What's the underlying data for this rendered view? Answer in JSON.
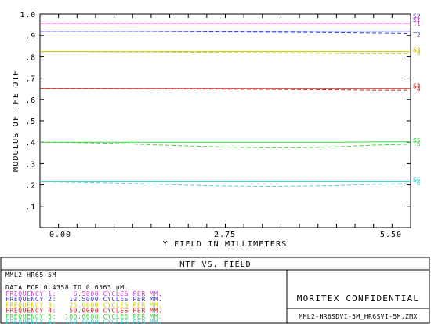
{
  "chart_data": {
    "type": "line",
    "title": "MTF VS. FIELD",
    "xlabel": "Y FIELD IN MILLIMETERS",
    "ylabel": "MODULUS OF THE OTF",
    "xlim": [
      0,
      5.5
    ],
    "ylim": [
      0,
      1.0
    ],
    "x_tick_labels": [
      "0.00",
      "2.75",
      "5.50"
    ],
    "y_tick_labels": [
      "1.0",
      ".9",
      ".8",
      ".7",
      ".6",
      ".5",
      ".4",
      ".3",
      ".2",
      ".1"
    ],
    "y_tick_values": [
      1.0,
      0.9,
      0.8,
      0.7,
      0.6,
      0.5,
      0.4,
      0.3,
      0.2,
      0.1
    ],
    "x_minor_ticks": 20,
    "x": [
      0,
      0.55,
      1.1,
      1.65,
      2.2,
      2.75,
      3.3,
      3.85,
      4.4,
      4.95,
      5.5
    ],
    "series": [
      {
        "name": "S1",
        "color": "#d03cd0",
        "dashed": false,
        "values": [
          0.955,
          0.955,
          0.955,
          0.955,
          0.955,
          0.955,
          0.955,
          0.955,
          0.955,
          0.955,
          0.955
        ]
      },
      {
        "name": "T1",
        "color": "#d03cd0",
        "dashed": true,
        "values": [
          0.955,
          0.955,
          0.955,
          0.955,
          0.955,
          0.955,
          0.955,
          0.955,
          0.955,
          0.955,
          0.955
        ]
      },
      {
        "name": "S2",
        "color": "#3c3cd0",
        "dashed": false,
        "values": [
          0.92,
          0.92,
          0.92,
          0.92,
          0.92,
          0.92,
          0.92,
          0.92,
          0.92,
          0.92,
          0.92
        ]
      },
      {
        "name": "T2",
        "color": "#3c3cd0",
        "dashed": true,
        "values": [
          0.92,
          0.92,
          0.92,
          0.919,
          0.918,
          0.917,
          0.916,
          0.915,
          0.914,
          0.912,
          0.91
        ]
      },
      {
        "name": "S3",
        "color": "#c8c800",
        "dashed": false,
        "values": [
          0.825,
          0.825,
          0.825,
          0.825,
          0.825,
          0.825,
          0.825,
          0.825,
          0.825,
          0.825,
          0.825
        ]
      },
      {
        "name": "T3",
        "color": "#c8c800",
        "dashed": true,
        "values": [
          0.825,
          0.825,
          0.824,
          0.823,
          0.822,
          0.82,
          0.819,
          0.818,
          0.816,
          0.815,
          0.815
        ]
      },
      {
        "name": "S4",
        "color": "#d82020",
        "dashed": false,
        "values": [
          0.652,
          0.652,
          0.652,
          0.652,
          0.652,
          0.652,
          0.652,
          0.652,
          0.652,
          0.652,
          0.652
        ]
      },
      {
        "name": "T4",
        "color": "#d82020",
        "dashed": true,
        "values": [
          0.652,
          0.652,
          0.651,
          0.65,
          0.649,
          0.648,
          0.647,
          0.646,
          0.645,
          0.643,
          0.643
        ]
      },
      {
        "name": "S5",
        "color": "#3cd83c",
        "dashed": false,
        "values": [
          0.4,
          0.4,
          0.4,
          0.4,
          0.4,
          0.4,
          0.4,
          0.4,
          0.4,
          0.401,
          0.402
        ]
      },
      {
        "name": "T5",
        "color": "#3cd83c",
        "dashed": true,
        "values": [
          0.4,
          0.398,
          0.394,
          0.388,
          0.382,
          0.377,
          0.374,
          0.374,
          0.378,
          0.386,
          0.39
        ]
      },
      {
        "name": "S6",
        "color": "#3cd8d8",
        "dashed": false,
        "values": [
          0.215,
          0.215,
          0.215,
          0.215,
          0.215,
          0.215,
          0.215,
          0.215,
          0.215,
          0.215,
          0.215
        ]
      },
      {
        "name": "T6",
        "color": "#3cd8d8",
        "dashed": true,
        "values": [
          0.215,
          0.213,
          0.209,
          0.204,
          0.199,
          0.195,
          0.193,
          0.194,
          0.197,
          0.203,
          0.206
        ]
      }
    ],
    "right_labels": [
      {
        "text": "S2",
        "value": 0.99,
        "color": "#3c3cd0"
      },
      {
        "text": "S1",
        "value": 0.975,
        "color": "#d03cd0"
      },
      {
        "text": "T1",
        "value": 0.955,
        "color": "#d03cd0"
      },
      {
        "text": "T2",
        "value": 0.905,
        "color": "#3c3cd0"
      },
      {
        "text": "S3",
        "value": 0.832,
        "color": "#c8c800"
      },
      {
        "text": "T3",
        "value": 0.818,
        "color": "#c8c800"
      },
      {
        "text": "S4",
        "value": 0.664,
        "color": "#d82020"
      },
      {
        "text": "T4",
        "value": 0.648,
        "color": "#d82020"
      },
      {
        "text": "S5",
        "value": 0.408,
        "color": "#3cd83c"
      },
      {
        "text": "T5",
        "value": 0.393,
        "color": "#3cd83c"
      },
      {
        "text": "S6",
        "value": 0.225,
        "color": "#3cd8d8"
      },
      {
        "text": "T6",
        "value": 0.209,
        "color": "#3cd8d8"
      }
    ]
  },
  "footer": {
    "title": "MTF VS. FIELD",
    "lens_name": "MML2-HR65-5M",
    "data_line": "DATA FOR 0.4358 TO 0.6563 µM.",
    "frequencies": [
      {
        "text": "FREQUENCY 1:    6.5000 CYCLES PER MM.",
        "color": "#d03cd0"
      },
      {
        "text": "FREQUENCY 2:   12.5000 CYCLES PER MM.",
        "color": "#3c3cd0"
      },
      {
        "text": "FREQUENCY 3:   25.0000 CYCLES PER MM.",
        "color": "#c8c800"
      },
      {
        "text": "FREQUENCY 4:   50.0000 CYCLES PER MM.",
        "color": "#d82020"
      },
      {
        "text": "FREQUENCY 5:  100.0000 CYCLES PER MM.",
        "color": "#3cd83c"
      },
      {
        "text": "FREQUENCY 6:  150.0000 CYCLES PER MM.",
        "color": "#3cd8d8"
      }
    ],
    "confidential": "MORITEX CONFIDENTIAL",
    "filename": "MML2-HR6SDVI-5M_HR6SVI-5M.ZMX"
  }
}
